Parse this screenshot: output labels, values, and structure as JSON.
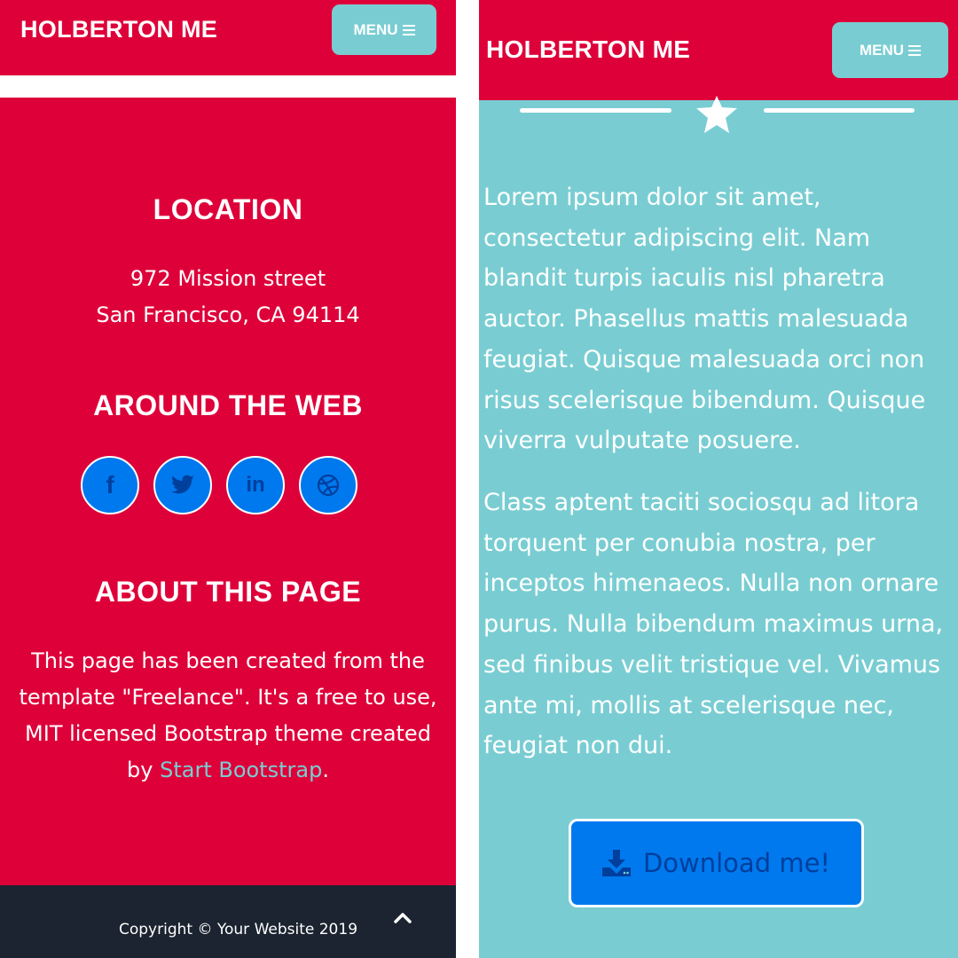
{
  "left": {
    "navbar": {
      "brand": "HOLBERTON ME",
      "menu_label": "MENU"
    },
    "footer": {
      "location_heading": "LOCATION",
      "address_line1": "972 Mission street",
      "address_line2": "San Francisco, CA 94114",
      "web_heading": "AROUND THE WEB",
      "social": [
        {
          "name": "facebook-icon",
          "glyph": "f"
        },
        {
          "name": "twitter-icon",
          "glyph": ""
        },
        {
          "name": "linkedin-icon",
          "glyph": "in"
        },
        {
          "name": "dribbble-icon",
          "glyph": ""
        }
      ],
      "about_heading": "ABOUT THIS PAGE",
      "about_line1": "This page has been created from the",
      "about_line2": "template \"Freelance\". It's a free to use,",
      "about_line3": "MIT licensed Bootstrap theme created",
      "about_by": "by",
      "about_link": "Start Bootstrap",
      "about_period": "."
    },
    "copyright": "Copyright © Your Website 2019"
  },
  "right": {
    "navbar": {
      "brand": "HOLBERTON ME",
      "menu_label": "MENU"
    },
    "paragraph1": "Lorem ipsum dolor sit amet, consectetur adipiscing elit. Nam blandit turpis iaculis nisl pharetra auctor. Phasellus mattis malesuada feugiat. Quisque malesuada orci non risus scelerisque bibendum. Quisque viverra vulputate posuere.",
    "paragraph2": "Class aptent taciti sociosqu ad litora torquent per conubia nostra, per inceptos himenaeos. Nulla non ornare purus. Nulla bibendum maximus urna, sed finibus velit tristique vel. Vivamus ante mi, mollis at scelerisque nec, feugiat non dui.",
    "download_label": "Download me!"
  },
  "colors": {
    "primary_red": "#de0039",
    "teal": "#79cdd2",
    "button_blue": "#0079ee",
    "icon_dark_blue": "#003f9c",
    "footer_dark": "#1b2430"
  }
}
